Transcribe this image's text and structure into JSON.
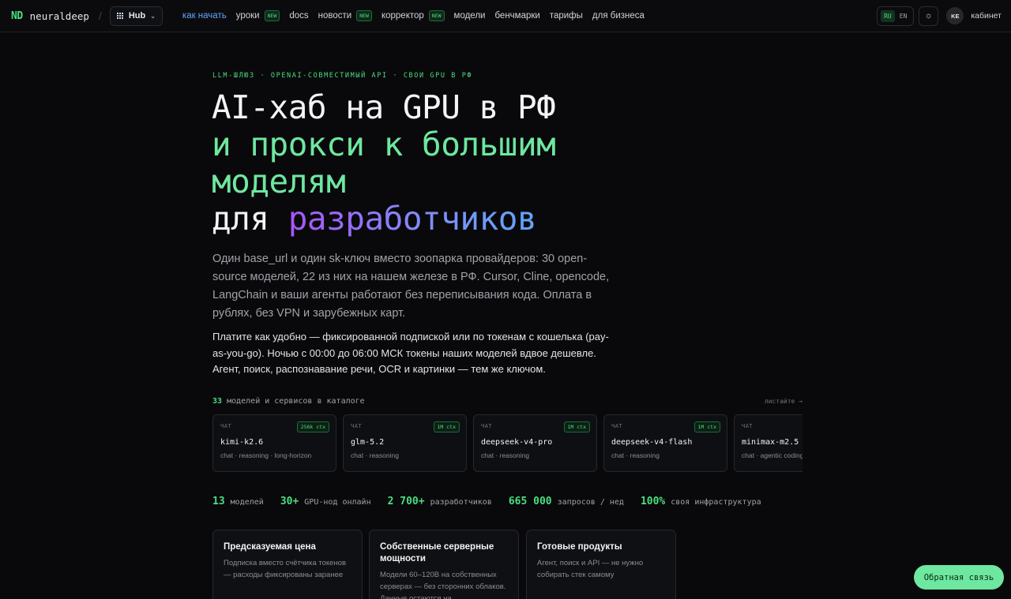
{
  "nav": {
    "logo_mark": "ND",
    "logo_text": "neuraldeep",
    "separator": "/",
    "hub_label": "Hub",
    "menu": [
      {
        "label": "как начать",
        "active": true,
        "new": false
      },
      {
        "label": "уроки",
        "active": false,
        "new": true
      },
      {
        "label": "docs",
        "active": false,
        "new": false
      },
      {
        "label": "новости",
        "active": false,
        "new": true
      },
      {
        "label": "корректор",
        "active": false,
        "new": true
      },
      {
        "label": "модели",
        "active": false,
        "new": false
      },
      {
        "label": "бенчмарки",
        "active": false,
        "new": false
      },
      {
        "label": "тарифы",
        "active": false,
        "new": false
      },
      {
        "label": "для бизнеса",
        "active": false,
        "new": false
      }
    ],
    "new_badge": "NEW",
    "lang_ru": "RU",
    "lang_en": "EN",
    "theme_icon": "☼",
    "avatar": "KE",
    "cabinet": "кабинет"
  },
  "hero": {
    "eyebrow": "LLM-ШЛЮЗ · OPENAI-СОВМЕСТИМЫЙ API · СВОИ GPU В РФ",
    "line1": "AI-хаб на GPU в РФ",
    "line2": "и прокси к большим",
    "line3": "моделям",
    "line4_plain": "для ",
    "line4_grad": "разработчиков",
    "lead": "Один base_url и один sk-ключ вместо зоопарка провайдеров: 30 open-source моделей, 22 из них на нашем железе в РФ. Cursor, Cline, opencode, LangChain и ваши агенты работают без переписывания кода. Оплата в рублях, без VPN и зарубежных карт.",
    "lead2": "Платите как удобно — фиксированной подпиской или по токенам с кошелька (pay-as-you-go). Ночью с 00:00 до 06:00 МСК токены наших моделей вдвое дешевле. Агент, поиск, распознавание речи, OCR и картинки — тем же ключом."
  },
  "catalog": {
    "count": "33",
    "title": "моделей и сервисов в каталоге",
    "swipe": "листайте →",
    "cards": [
      {
        "kind": "ЧАТ",
        "ctx": "256k ctx",
        "name": "kimi-k2.6",
        "tags": "chat · reasoning · long-horizon"
      },
      {
        "kind": "ЧАТ",
        "ctx": "1M ctx",
        "name": "glm-5.2",
        "tags": "chat · reasoning"
      },
      {
        "kind": "ЧАТ",
        "ctx": "1M ctx",
        "name": "deepseek-v4-pro",
        "tags": "chat · reasoning"
      },
      {
        "kind": "ЧАТ",
        "ctx": "1M ctx",
        "name": "deepseek-v4-flash",
        "tags": "chat · reasoning"
      },
      {
        "kind": "ЧАТ",
        "ctx": "",
        "name": "minimax-m2.5",
        "tags": "chat · agentic coding"
      }
    ]
  },
  "stats": [
    {
      "value": "13",
      "label": "моделей"
    },
    {
      "value": "30+",
      "label": "GPU-нод онлайн"
    },
    {
      "value": "2 700+",
      "label": "разработчиков"
    },
    {
      "value": "665 000",
      "label": "запросов / нед"
    },
    {
      "value": "100%",
      "label": "своя инфраструктура"
    }
  ],
  "features": [
    {
      "title": "Предсказуемая цена",
      "text": "Подписка вместо счётчика токенов — расходы фиксированы заранее"
    },
    {
      "title": "Собственные серверные мощности",
      "text": "Модели 60–120B на собственных серверах — без сторонних облаков. Данные остаются на"
    },
    {
      "title": "Готовые продукты",
      "text": "Агент, поиск и API — не нужно собирать стек самому"
    }
  ],
  "feedback": "Обратная связь",
  "colors": {
    "accent": "#4ade80",
    "link_active": "#60a5fa",
    "background": "#09090b"
  }
}
